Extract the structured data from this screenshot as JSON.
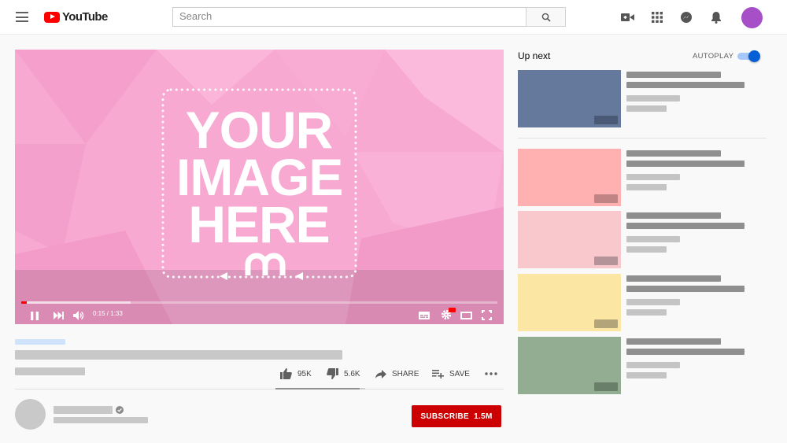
{
  "header": {
    "logo_text": "YouTube",
    "search_placeholder": "Search"
  },
  "player": {
    "image_text_lines": [
      "YOUR",
      "IMAGE",
      "HERE"
    ],
    "time": "0:15 / 1:33",
    "progress_played_fraction": 0.011,
    "progress_buffered_fraction": 0.23
  },
  "actions": {
    "likes": "95K",
    "dislikes": "5.6K",
    "share_label": "SHARE",
    "save_label": "SAVE"
  },
  "channel": {
    "subscribe_label": "SUBSCRIBE",
    "subscriber_count": "1.5M"
  },
  "sidebar": {
    "up_next_label": "Up next",
    "autoplay_label": "AUTOPLAY",
    "autoplay_on": true,
    "videos": [
      {
        "thumb_color": "#64799c",
        "badge_color": "#4a5a76"
      },
      {
        "thumb_color": "#ffb0b0",
        "badge_color": "#c08484"
      },
      {
        "thumb_color": "#f8c8cc",
        "badge_color": "#b49498"
      },
      {
        "thumb_color": "#fbe6a4",
        "badge_color": "#b4a47a"
      },
      {
        "thumb_color": "#93ad93",
        "badge_color": "#6a7f6a"
      }
    ]
  },
  "colors": {
    "brand_red": "#ff0000",
    "subscribe_red": "#cc0000",
    "player_pink": "#f7a8d1",
    "toggle_blue": "#065fd4"
  }
}
